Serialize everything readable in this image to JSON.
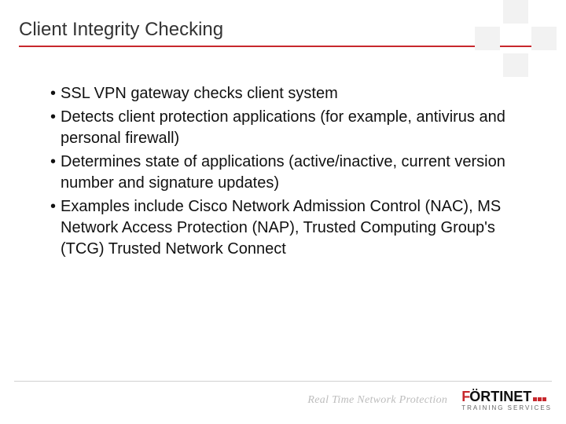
{
  "title": "Client Integrity Checking",
  "bullets": [
    "SSL VPN gateway checks client system",
    "Detects client protection applications (for example, antivirus and personal firewall)",
    "Determines state of applications (active/inactive, current version number and signature updates)",
    "Examples include Cisco Network Admission Control (NAC), MS Network Access Protection (NAP), Trusted Computing Group's (TCG) Trusted Network Connect"
  ],
  "footer": {
    "tagline": "Real Time Network Protection",
    "logo_main_f": "F",
    "logo_main_rest": "ÖRTINET",
    "logo_sub": "TRAINING SERVICES"
  },
  "colors": {
    "accent": "#c7282d"
  }
}
